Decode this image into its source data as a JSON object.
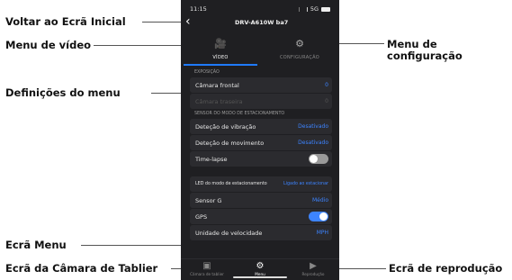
{
  "callouts": {
    "back": "Voltar ao Ecrã Inicial",
    "video_menu": "Menu de vídeo",
    "config_menu": "Menu de configuração",
    "menu_settings": "Definições do menu",
    "menu_screen": "Ecrã Menu",
    "dashcam_screen": "Ecrã da Câmara de Tablier",
    "playback_screen": "Ecrã de reprodução"
  },
  "phone": {
    "status": {
      "time": "11:15",
      "network": "5G"
    },
    "nav": {
      "title": "DRV-A610W ba7"
    },
    "tabs": [
      {
        "label": "VÍDEO",
        "icon": "video-settings-icon",
        "active": true
      },
      {
        "label": "CONFIGURAÇÃO",
        "icon": "gears-icon",
        "active": false
      }
    ],
    "sections": {
      "exposure": "EXPOSIÇÃO",
      "parking_sensor": "SENSOR DO MODO DE ESTACIONAMENTO"
    },
    "rows": {
      "front_camera": {
        "label": "Câmara frontal",
        "value": "0"
      },
      "rear_camera": {
        "label": "Câmara traseira",
        "value": "0"
      },
      "vibration": {
        "label": "Deteção de vibração",
        "value": "Desativado"
      },
      "motion": {
        "label": "Deteção de movimento",
        "value": "Desativado"
      },
      "timelapse": {
        "label": "Time-lapse",
        "toggle": "off"
      },
      "parking_led": {
        "label": "LED do modo de estacionamento",
        "value": "Ligado ao estacionar"
      },
      "gsensor": {
        "label": "Sensor G",
        "value": "Médio"
      },
      "gps": {
        "label": "GPS",
        "toggle": "on"
      },
      "speed_unit": {
        "label": "Unidade de velocidade",
        "value": "MPH"
      }
    },
    "bottom_nav": [
      {
        "label": "Câmara de tablier",
        "icon": "camera-icon"
      },
      {
        "label": "Menu",
        "icon": "gear-icon"
      },
      {
        "label": "Reprodução",
        "icon": "play-icon"
      }
    ]
  }
}
